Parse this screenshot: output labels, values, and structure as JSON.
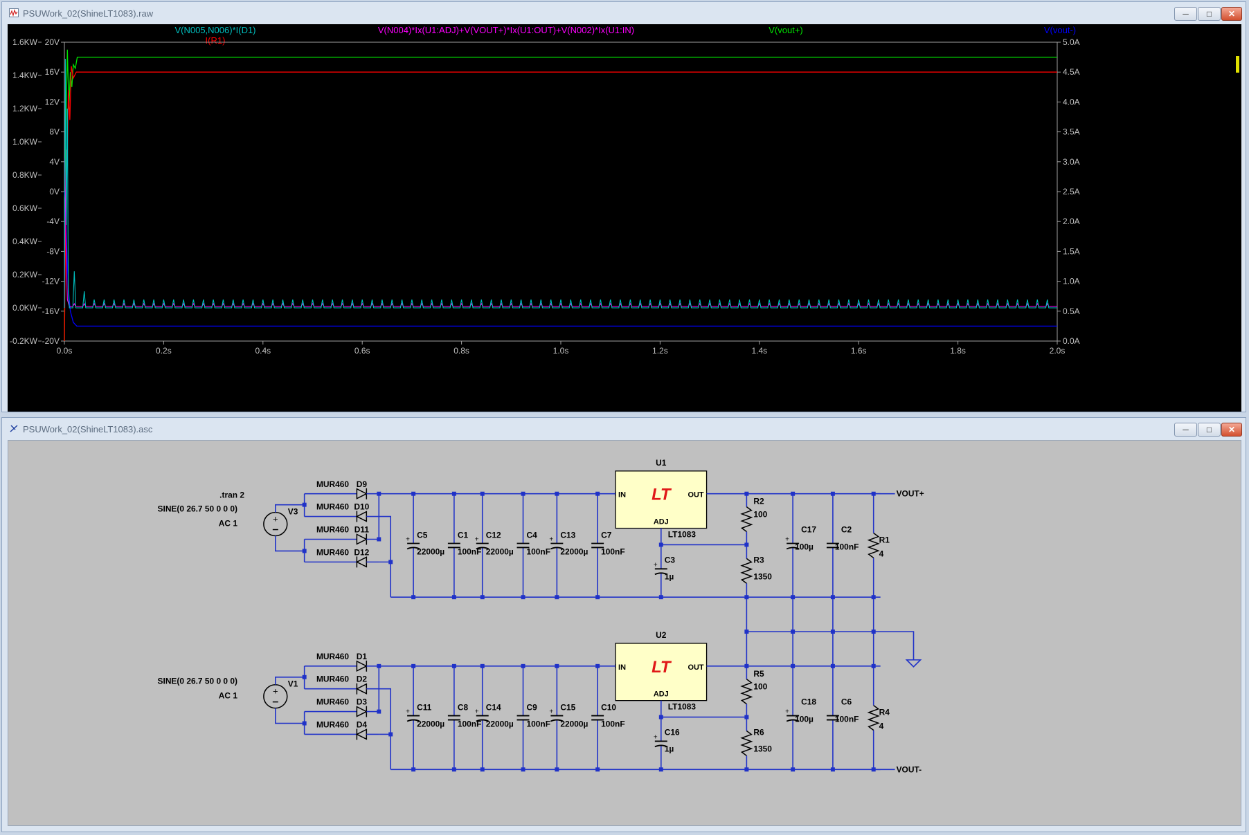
{
  "colors": {
    "cyan": "#00bfbf",
    "red": "#ff0000",
    "magenta": "#ff00ff",
    "green": "#00e400",
    "blue": "#0000ff",
    "wire": "#2032c8",
    "comp": "#000000",
    "axis": "#a0a0a0",
    "label": "#000000"
  },
  "waveform_window": {
    "title": "PSUWork_02(ShineLT1083).raw",
    "icon": "waveform-icon",
    "buttons": {
      "minimize": "─",
      "maximize": "□",
      "close": "✕"
    }
  },
  "schematic_window": {
    "title": "PSUWork_02(ShineLT1083).asc",
    "icon": "schematic-icon",
    "buttons": {
      "minimize": "─",
      "maximize": "□",
      "close": "✕"
    }
  },
  "chart_data": {
    "type": "line",
    "x": {
      "ticks": [
        "0.0s",
        "0.2s",
        "0.4s",
        "0.6s",
        "0.8s",
        "1.0s",
        "1.2s",
        "1.4s",
        "1.6s",
        "1.8s",
        "2.0s"
      ],
      "values": [
        0,
        0.2,
        0.4,
        0.6,
        0.8,
        1.0,
        1.2,
        1.4,
        1.6,
        1.8,
        2.0
      ],
      "range": [
        0,
        2.0
      ]
    },
    "y_left_outer": {
      "ticks": [
        "1.6KW",
        "1.4KW",
        "1.2KW",
        "1.0KW",
        "0.8KW",
        "0.6KW",
        "0.4KW",
        "0.2KW",
        "0.0KW",
        "-0.2KW"
      ],
      "range": [
        -0.2,
        1.6
      ]
    },
    "y_left_inner": {
      "ticks": [
        "20V",
        "16V",
        "12V",
        "8V",
        "4V",
        "0V",
        "-4V",
        "-8V",
        "-12V",
        "-16V",
        "-20V"
      ],
      "range": [
        -20,
        20
      ]
    },
    "y_right": {
      "ticks": [
        "5.0A",
        "4.5A",
        "4.0A",
        "3.5A",
        "3.0A",
        "2.5A",
        "2.0A",
        "1.5A",
        "1.0A",
        "0.5A",
        "0.0A"
      ],
      "range": [
        0,
        5
      ]
    },
    "grid": false,
    "series": [
      {
        "name": "V(N005,N006)*I(D1)",
        "color": "cyan",
        "steady_kw": 0.0
      },
      {
        "name": "I(R1)",
        "color": "red",
        "steady": 4.5
      },
      {
        "name": "V(N004)*Ix(U1:ADJ)+V(VOUT+)*Ix(U1:OUT)+V(N002)*Ix(U1:IN)",
        "color": "magenta",
        "steady_kw": 0.0
      },
      {
        "name": "V(vout+)",
        "color": "green",
        "steady": 18.0
      },
      {
        "name": "V(vout-)",
        "color": "blue",
        "steady": -18.0
      }
    ]
  },
  "schematic": {
    "directive": ".tran 2",
    "upper": {
      "source": {
        "name": "V3",
        "value": "SINE(0 26.7 50 0 0 0)",
        "ac": "AC 1"
      },
      "diodes": [
        {
          "ref": "D9",
          "model": "MUR460"
        },
        {
          "ref": "D10",
          "model": "MUR460"
        },
        {
          "ref": "D11",
          "model": "MUR460"
        },
        {
          "ref": "D12",
          "model": "MUR460"
        }
      ],
      "caps": [
        {
          "ref": "C5",
          "value": "22000µ",
          "polar": true
        },
        {
          "ref": "C1",
          "value": "100nF",
          "polar": false
        },
        {
          "ref": "C12",
          "value": "22000µ",
          "polar": true
        },
        {
          "ref": "C4",
          "value": "100nF",
          "polar": false
        },
        {
          "ref": "C13",
          "value": "22000µ",
          "polar": true
        },
        {
          "ref": "C7",
          "value": "100nF",
          "polar": false
        }
      ],
      "regulator": {
        "ref": "U1",
        "part": "LT1083",
        "in": "IN",
        "out": "OUT",
        "adj": "ADJ"
      },
      "adj_cap": {
        "ref": "C3",
        "value": "1µ"
      },
      "r_top": {
        "ref": "R2",
        "value": "100"
      },
      "r_bottom": {
        "ref": "R3",
        "value": "1350"
      },
      "out_caps": [
        {
          "ref": "C17",
          "value": "100µ",
          "polar": true
        },
        {
          "ref": "C2",
          "value": "100nF",
          "polar": false
        }
      ],
      "load": {
        "ref": "R1",
        "value": "4"
      },
      "net": "VOUT+"
    },
    "lower": {
      "source": {
        "name": "V1",
        "value": "SINE(0 26.7 50 0 0 0)",
        "ac": "AC 1"
      },
      "diodes": [
        {
          "ref": "D1",
          "model": "MUR460"
        },
        {
          "ref": "D2",
          "model": "MUR460"
        },
        {
          "ref": "D3",
          "model": "MUR460"
        },
        {
          "ref": "D4",
          "model": "MUR460"
        }
      ],
      "caps": [
        {
          "ref": "C11",
          "value": "22000µ",
          "polar": true
        },
        {
          "ref": "C8",
          "value": "100nF",
          "polar": false
        },
        {
          "ref": "C14",
          "value": "22000µ",
          "polar": true
        },
        {
          "ref": "C9",
          "value": "100nF",
          "polar": false
        },
        {
          "ref": "C15",
          "value": "22000µ",
          "polar": true
        },
        {
          "ref": "C10",
          "value": "100nF",
          "polar": false
        }
      ],
      "regulator": {
        "ref": "U2",
        "part": "LT1083",
        "in": "IN",
        "out": "OUT",
        "adj": "ADJ"
      },
      "adj_cap": {
        "ref": "C16",
        "value": "1µ"
      },
      "r_top": {
        "ref": "R5",
        "value": "100"
      },
      "r_bottom": {
        "ref": "R6",
        "value": "1350"
      },
      "out_caps": [
        {
          "ref": "C18",
          "value": "100µ",
          "polar": true
        },
        {
          "ref": "C6",
          "value": "100nF",
          "polar": false
        }
      ],
      "load": {
        "ref": "R4",
        "value": "4"
      },
      "net": "VOUT-"
    }
  }
}
